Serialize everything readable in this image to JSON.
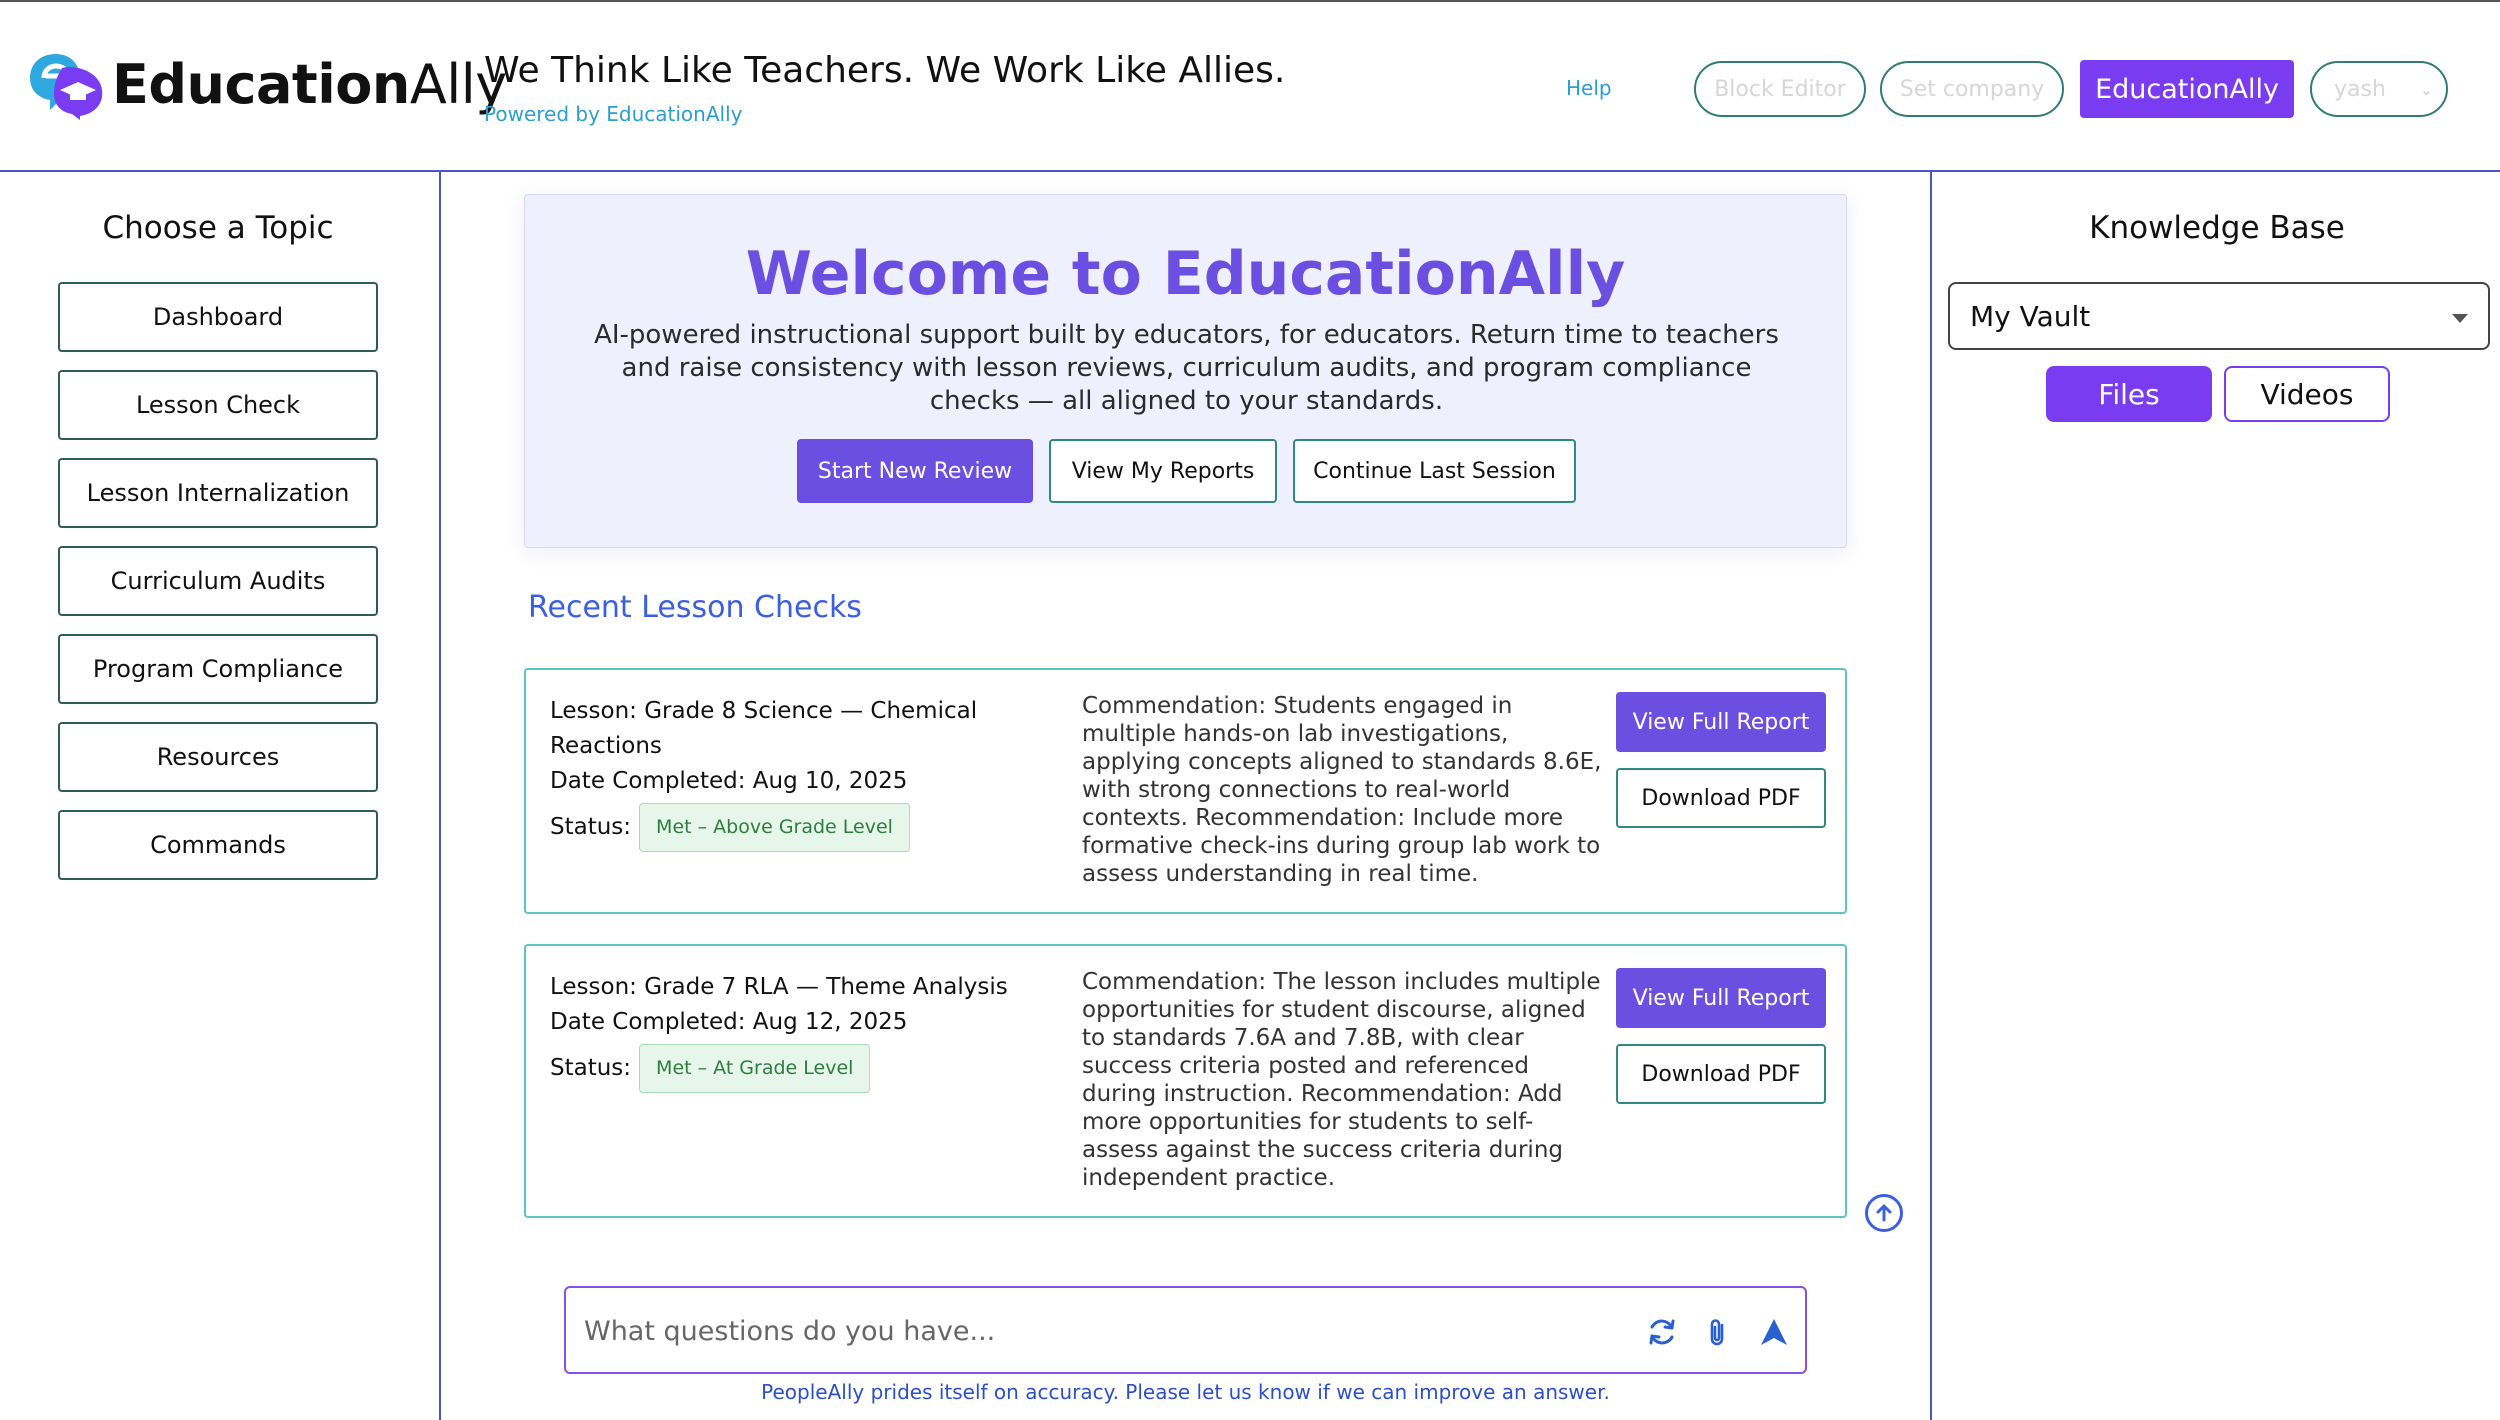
{
  "header": {
    "logo_bold": "Education",
    "logo_light": "Ally",
    "tagline": "We Think Like Teachers. We Work Like Allies.",
    "powered_by": "Powered by EducationAlly",
    "help_label": "Help",
    "block_editor_label": "Block Editor",
    "set_company_label": "Set company",
    "brand_button_label": "EducationAlly",
    "user_label": "yash"
  },
  "sidebar": {
    "title": "Choose a Topic",
    "items": [
      {
        "label": "Dashboard"
      },
      {
        "label": "Lesson Check"
      },
      {
        "label": "Lesson Internalization"
      },
      {
        "label": "Curriculum Audits"
      },
      {
        "label": "Program Compliance"
      },
      {
        "label": "Resources"
      },
      {
        "label": "Commands"
      }
    ]
  },
  "welcome": {
    "title": "Welcome to EducationAlly",
    "description": "AI-powered instructional support built by educators, for educators. Return time to teachers and raise consistency with lesson reviews, curriculum audits, and program compliance checks — all aligned to your standards.",
    "start_label": "Start New Review",
    "reports_label": "View My Reports",
    "continue_label": "Continue Last Session"
  },
  "recent": {
    "title": "Recent Lesson Checks",
    "status_prefix": "Status:",
    "view_label": "View Full Report",
    "pdf_label": "Download PDF",
    "checks": [
      {
        "lesson": "Lesson: Grade 8 Science — Chemical Reactions",
        "date": "Date Completed: Aug 10, 2025",
        "status": "Met – Above Grade Level",
        "notes": "Commendation: Students engaged in multiple hands-on lab investigations, applying concepts aligned to standards 8.6E, with strong connections to real-world contexts. Recommendation: Include more formative check-ins during group lab work to assess understanding in real time."
      },
      {
        "lesson": "Lesson: Grade 7 RLA — Theme Analysis",
        "date": "Date Completed: Aug 12, 2025",
        "status": "Met – At Grade Level",
        "notes": "Commendation: The lesson includes multiple opportunities for student discourse, aligned to standards 7.6A and 7.8B, with clear success criteria posted and referenced during instruction. Recommendation: Add more opportunities for students to self-assess against the success criteria during independent practice."
      }
    ]
  },
  "chat": {
    "placeholder": "What questions do you have...",
    "disclaimer": "PeopleAlly prides itself on accuracy. Please let us know if we can improve an answer."
  },
  "knowledge_base": {
    "title": "Knowledge Base",
    "selected_vault": "My Vault",
    "tabs": [
      {
        "label": "Files",
        "active": true
      },
      {
        "label": "Videos",
        "active": false
      }
    ]
  },
  "colors": {
    "brand_purple": "#7a3cf0",
    "button_purple": "#6b4fe0",
    "link_blue": "#2a9fd0",
    "divider_blue": "#4a55c8",
    "card_border": "#5fc4c0",
    "status_green": "#2e7d3e"
  },
  "icons": [
    "logo-mark-icon",
    "chevron-down-icon",
    "caret-down-icon",
    "arrow-up-circle-icon",
    "refresh-icon",
    "paperclip-icon",
    "send-icon"
  ]
}
